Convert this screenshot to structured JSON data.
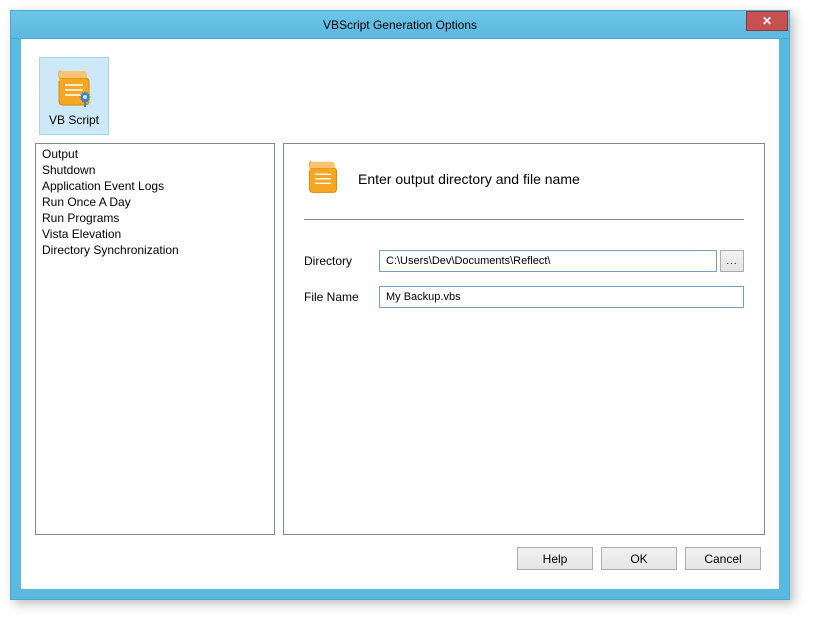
{
  "window": {
    "title": "VBScript Generation Options"
  },
  "toolbar": {
    "vbscript_label": "VB Script"
  },
  "sidebar": {
    "items": [
      "Output",
      "Shutdown",
      "Application Event Logs",
      "Run Once A Day",
      "Run Programs",
      "Vista Elevation",
      "Directory Synchronization"
    ]
  },
  "content": {
    "header_title": "Enter output directory and file name",
    "directory_label": "Directory",
    "directory_value": "C:\\Users\\Dev\\Documents\\Reflect\\",
    "browse_label": "...",
    "filename_label": "File Name",
    "filename_value": "My Backup.vbs"
  },
  "buttons": {
    "help": "Help",
    "ok": "OK",
    "cancel": "Cancel"
  }
}
